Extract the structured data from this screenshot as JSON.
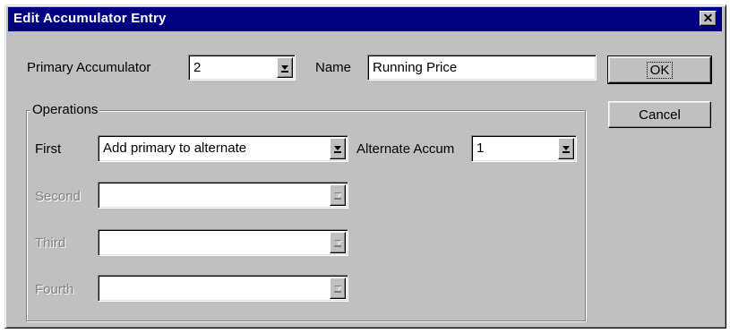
{
  "window": {
    "title": "Edit Accumulator Entry",
    "close_glyph": "✕"
  },
  "primary_accumulator": {
    "label": "Primary Accumulator",
    "value": "2"
  },
  "name_field": {
    "label": "Name",
    "value": "Running Price"
  },
  "buttons": {
    "ok": "OK",
    "cancel": "Cancel"
  },
  "operations": {
    "legend": "Operations",
    "first": {
      "label": "First",
      "value": "Add primary to alternate",
      "enabled": true
    },
    "second": {
      "label": "Second",
      "value": "",
      "enabled": false
    },
    "third": {
      "label": "Third",
      "value": "",
      "enabled": false
    },
    "fourth": {
      "label": "Fourth",
      "value": "",
      "enabled": false
    }
  },
  "alternate_accum": {
    "label": "Alternate Accum",
    "value": "1"
  },
  "icons": {
    "dropdown": "dropdown-arrow-icon",
    "close": "close-icon"
  },
  "colors": {
    "titlebar": "#000080",
    "face": "#c0c0c0",
    "disabled_text": "#808080"
  }
}
